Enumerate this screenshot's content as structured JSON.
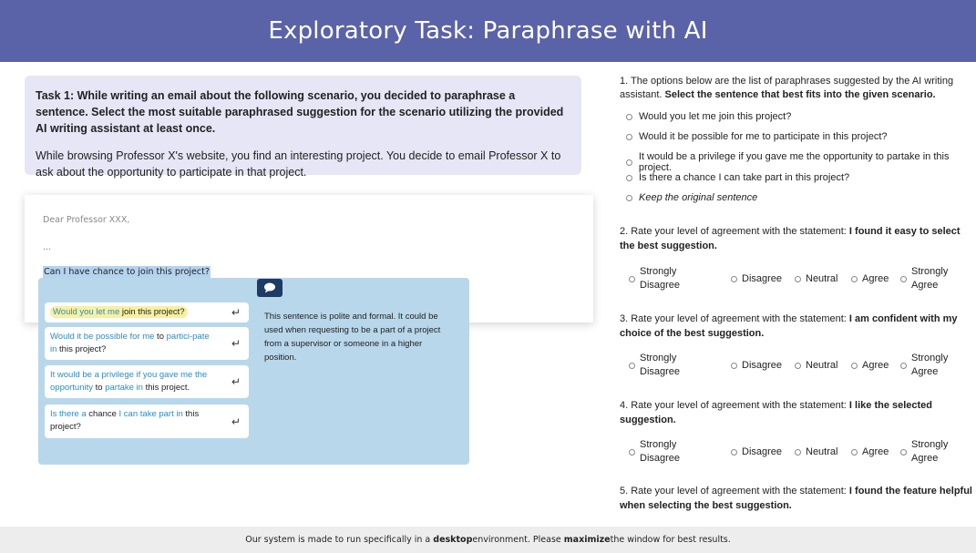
{
  "header": {
    "title": "Exploratory Task: Paraphrase with AI"
  },
  "task": {
    "title": "Task 1: While writing an email about the following scenario, you decided to paraphrase a sentence. Select the most suitable paraphrased suggestion for the scenario utilizing the provided AI writing assistant at least once.",
    "scenario": "While browsing Professor X's website, you find an interesting project. You decide to email Professor X to ask about the opportunity to participate in that project."
  },
  "email": {
    "greeting": "Dear Professor XXX,",
    "ellipsis": "...",
    "selected_sentence": "Can I have chance to join this project?"
  },
  "assistant": {
    "enter_icon": "↵",
    "suggestions": [
      {
        "parts": [
          [
            "Would you let me",
            "blue"
          ],
          [
            " join this project?",
            ""
          ]
        ]
      },
      {
        "parts": [
          [
            "Would it be possible for me",
            "blue"
          ],
          [
            " to ",
            ""
          ],
          [
            "partici-pate in",
            "blue"
          ],
          [
            " this project?",
            ""
          ]
        ]
      },
      {
        "parts": [
          [
            "It would be a privilege if you gave me the opportunity",
            "blue"
          ],
          [
            " to ",
            ""
          ],
          [
            "partake in",
            "blue"
          ],
          [
            " this project.",
            ""
          ]
        ]
      },
      {
        "parts": [
          [
            "Is there a",
            "blue"
          ],
          [
            " chance ",
            ""
          ],
          [
            "I can take part in",
            "blue"
          ],
          [
            " this project?",
            ""
          ]
        ]
      }
    ],
    "explanation": "This sentence is polite and formal. It could be used when requesting to be a part of a project from a supervisor or someone in a higher position."
  },
  "q1": {
    "text": "1. The options below are the list of paraphrases suggested by the AI writing assistant. ",
    "bold": "Select the sentence that best fits into the given scenario.",
    "options": [
      "Would you let me join this project?",
      "Would it be possible for me to participate in this project?",
      "It would be a privilege if you gave me the opportunity to partake in this project.",
      "Is there a chance I can take part in this project?",
      "Keep the original sentence"
    ]
  },
  "likert_labels": {
    "sd1": "Strongly",
    "sd2": "Disagree",
    "d": "Disagree",
    "n": "Neutral",
    "a": "Agree",
    "sa1": "Strongly",
    "sa2": "Agree"
  },
  "q2": {
    "text": "2. Rate your level of agreement with the statement: ",
    "bold": "I found it easy to select the best suggestion."
  },
  "q3": {
    "text": "3. Rate your level of agreement with the statement: ",
    "bold": "I am confident with my choice of the best suggestion."
  },
  "q4": {
    "text": "4. Rate your level of agreement with the statement: ",
    "bold": "I like the selected suggestion."
  },
  "q5": {
    "text": "5. Rate your level of agreement with the statement: ",
    "bold": "I found the feature helpful when selecting the best suggestion."
  },
  "footer": {
    "pre": "Our system is made to run specifically in a ",
    "b1": "desktop",
    "mid": " environment. Please ",
    "b2": "maximize",
    "post": " the window for best results."
  }
}
